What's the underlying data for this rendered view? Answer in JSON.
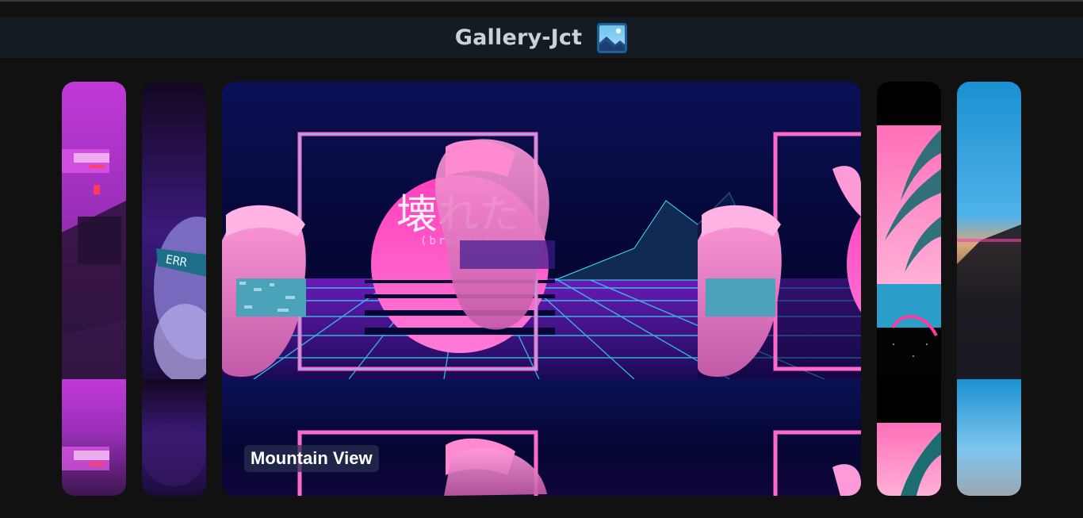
{
  "app": {
    "title": "Gallery-Jct",
    "title_icon": "framed-picture-icon"
  },
  "gallery": {
    "active_index": 2,
    "items": [
      {
        "alt": "neon-pink-street",
        "caption": ""
      },
      {
        "alt": "error-statue",
        "caption": ""
      },
      {
        "alt": "vaporwave-statue-mountains",
        "caption": "Mountain View"
      },
      {
        "alt": "palm-tree-sunset",
        "caption": ""
      },
      {
        "alt": "glitch-sky",
        "caption": ""
      }
    ],
    "active_caption": "Mountain View"
  },
  "art": {
    "kanji": "壊れた",
    "kanji_sub": "(broken)",
    "err_tag": "ERR"
  },
  "colors": {
    "background": "#111111",
    "header": "#151b22",
    "title": "#c9d1d9",
    "neon_pink": "#ff5fc8",
    "neon_cyan": "#35f0ff",
    "deep_blue": "#0a0f4a"
  }
}
